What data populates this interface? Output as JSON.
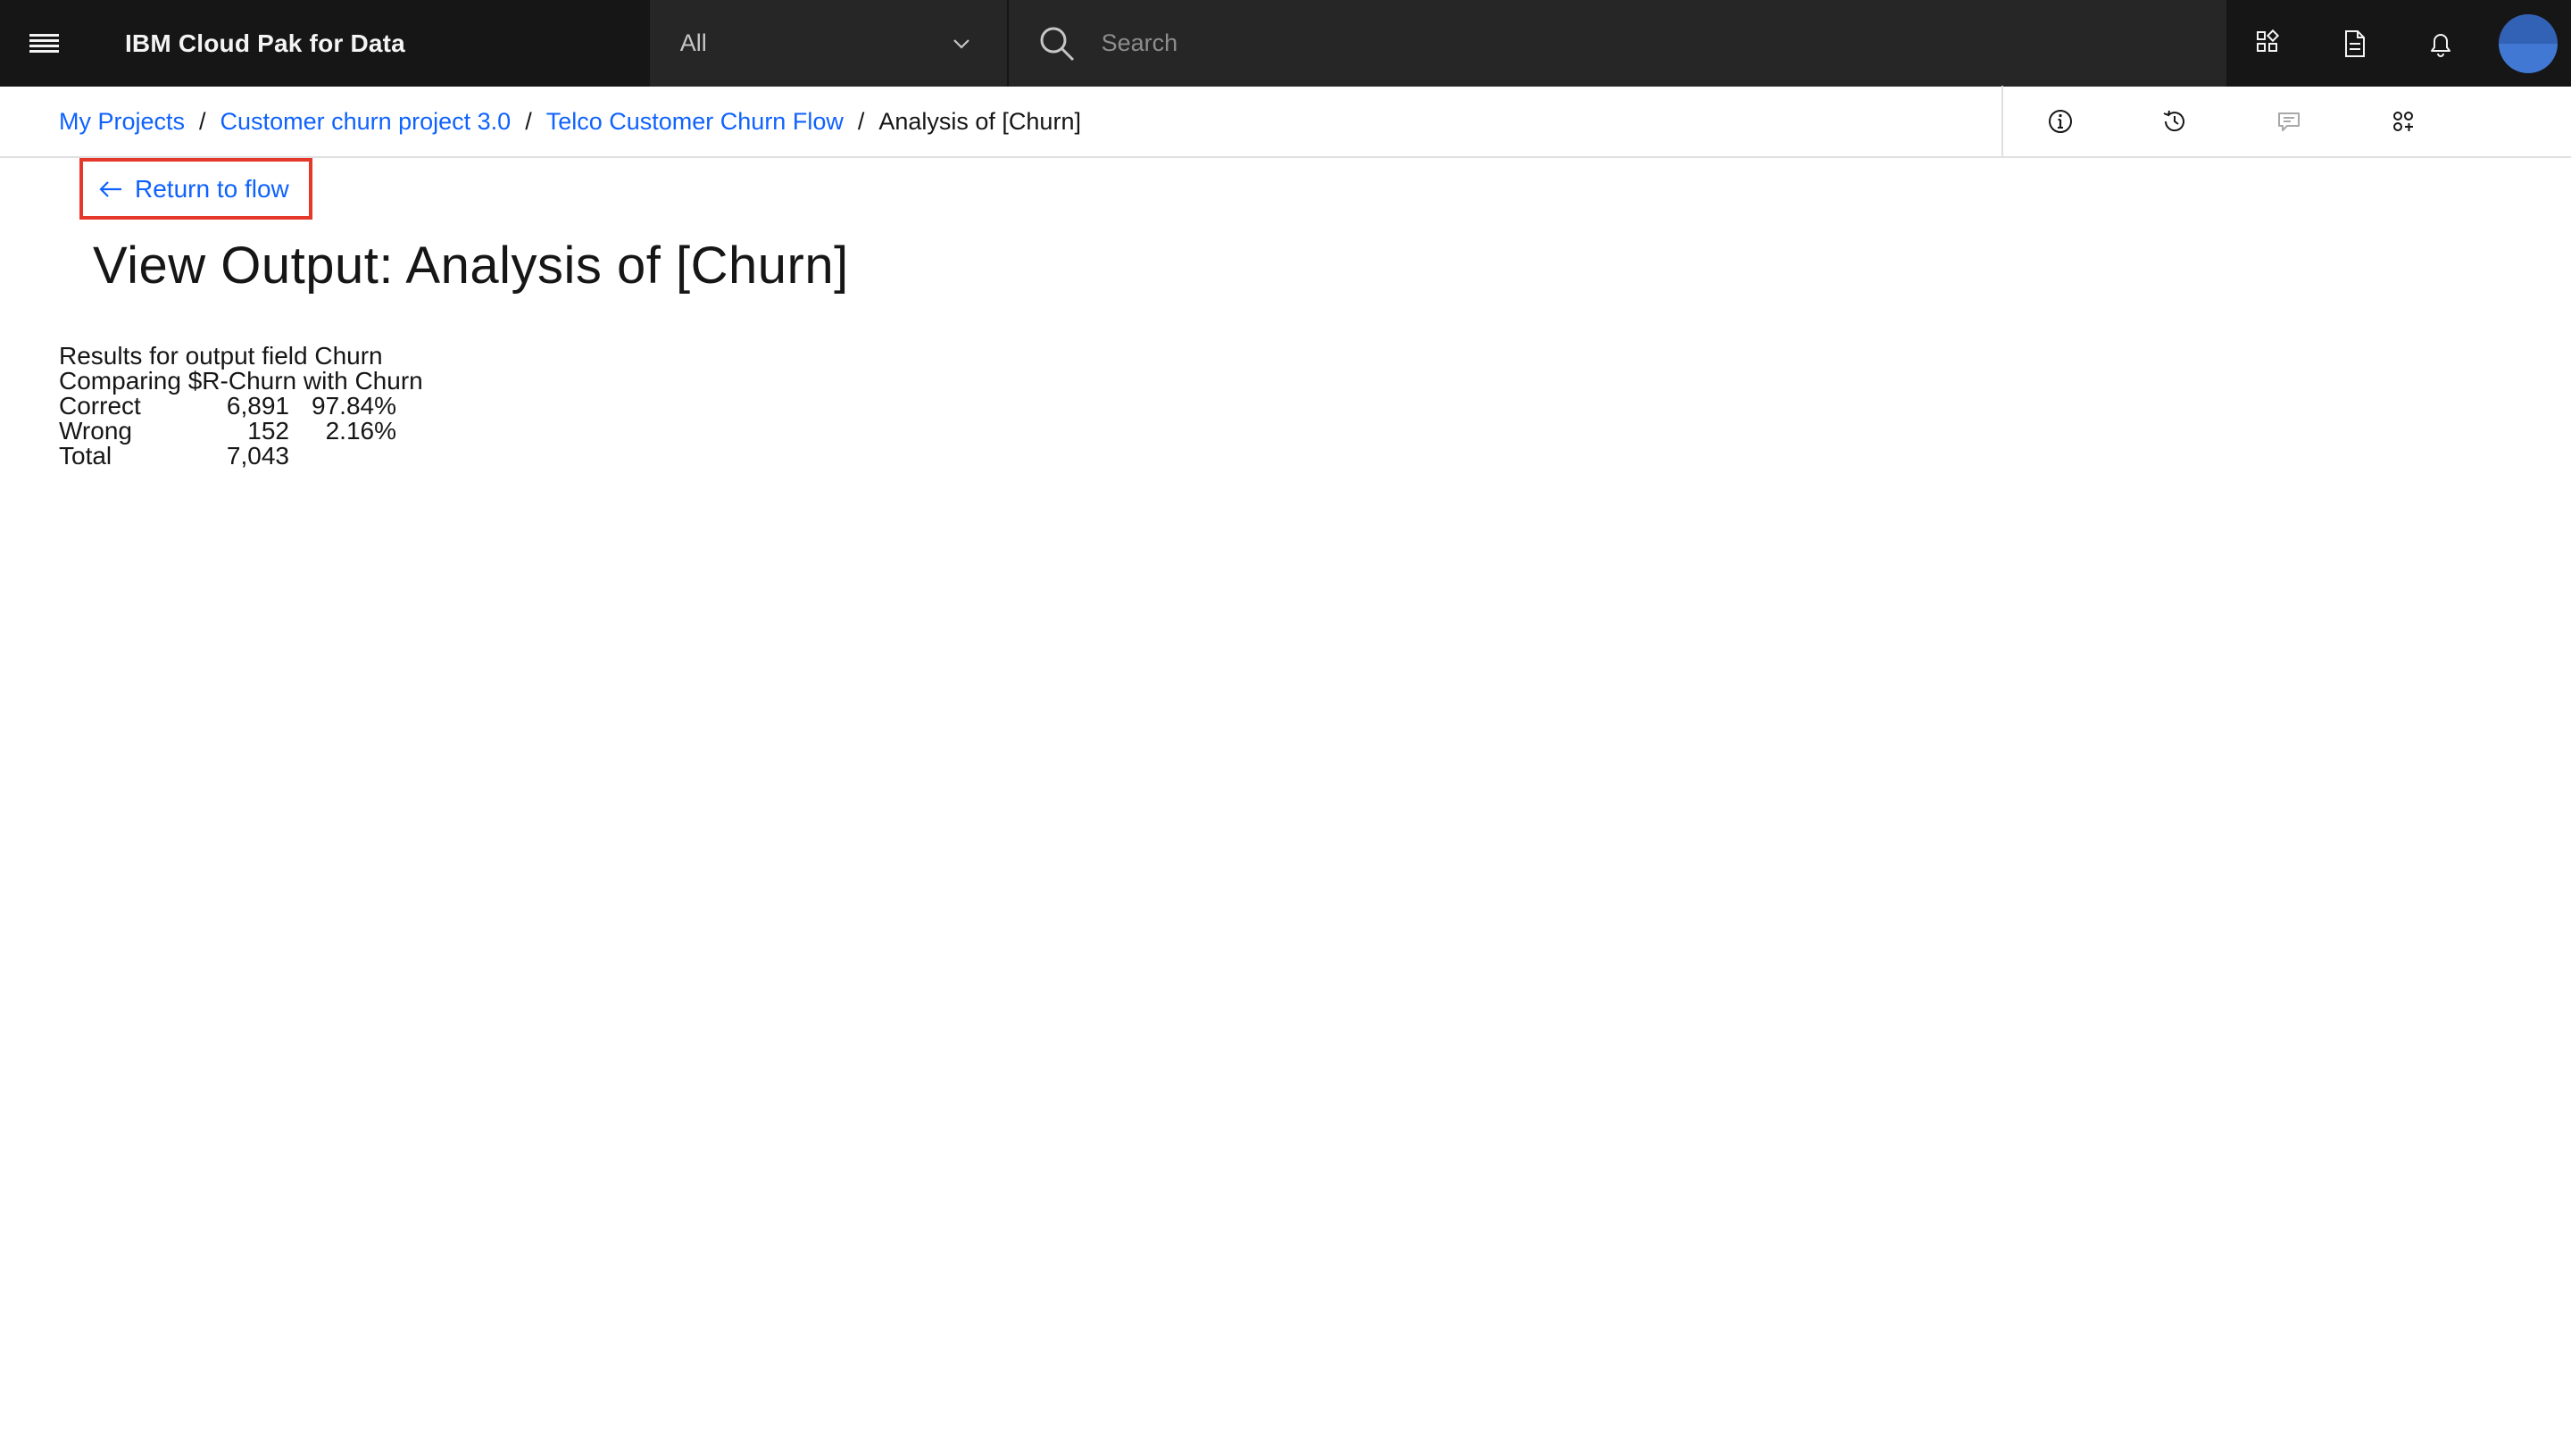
{
  "header": {
    "brand": "IBM Cloud Pak for Data",
    "scope_selected": "All",
    "search_placeholder": "Search",
    "actions": [
      "apps-switcher-icon",
      "document-icon",
      "notification-bell-icon"
    ]
  },
  "breadcrumb": {
    "items": [
      "My Projects",
      "Customer churn project 3.0",
      "Telco Customer Churn Flow"
    ],
    "current": "Analysis of [Churn]",
    "separator": "/"
  },
  "toolbar": {
    "icons": [
      "info-icon",
      "history-icon",
      "comment-icon",
      "settings-adjust-icon"
    ]
  },
  "main": {
    "return_label": "Return to flow",
    "title": "View Output: Analysis of [Churn]",
    "results": {
      "line1": "Results for output field Churn",
      "line2": "Comparing $R-Churn with Churn",
      "rows": [
        {
          "label": "Correct",
          "count": "6,891",
          "pct": "97.84%"
        },
        {
          "label": "Wrong",
          "count": "152",
          "pct": "2.16%"
        },
        {
          "label": "Total",
          "count": "7,043",
          "pct": ""
        }
      ]
    }
  },
  "colors": {
    "header_bg": "#161616",
    "field_bg": "#262626",
    "link": "#0f62fe",
    "highlight_border": "#e5372a",
    "avatar": "#4178d4"
  }
}
